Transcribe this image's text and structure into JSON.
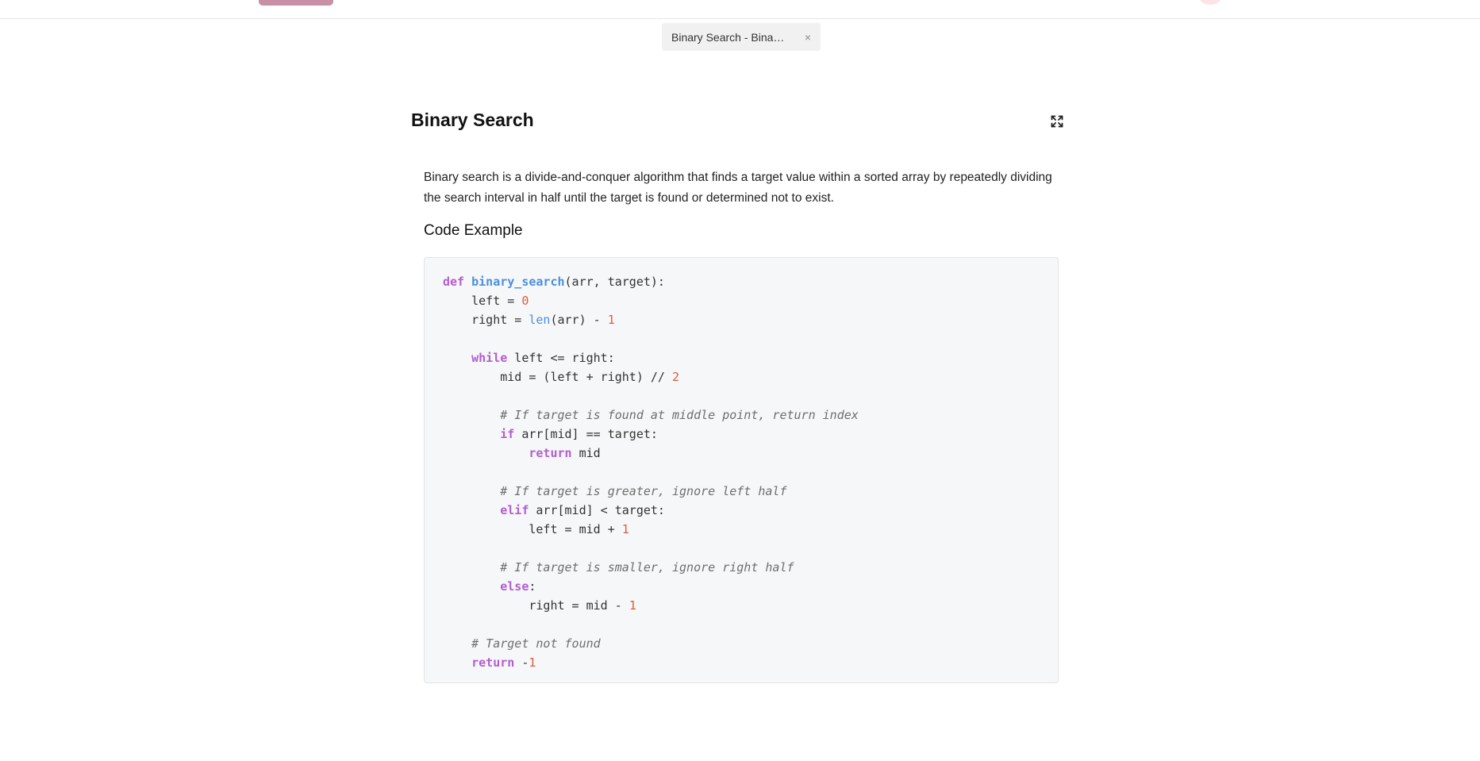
{
  "tab": {
    "title": "Binary Search - Binar…",
    "close_glyph": "×"
  },
  "document": {
    "title": "Binary Search",
    "expand_icon": "expand-icon",
    "description": "Binary search is a divide-and-conquer algorithm that finds a target value within a sorted array by repeatedly dividing the search interval in half until the target is found or determined not to exist.",
    "code_heading": "Code Example",
    "code_language": "python",
    "code_lines": [
      "def binary_search(arr, target):",
      "    left = 0",
      "    right = len(arr) - 1",
      "",
      "    while left <= right:",
      "        mid = (left + right) // 2",
      "",
      "        # If target is found at middle point, return index",
      "        if arr[mid] == target:",
      "            return mid",
      "",
      "        # If target is greater, ignore left half",
      "        elif arr[mid] < target:",
      "            left = mid + 1",
      "",
      "        # If target is smaller, ignore right half",
      "        else:",
      "            right = mid - 1",
      "",
      "    # Target not found",
      "    return -1"
    ]
  },
  "colors": {
    "keyword": "#b35ed0",
    "function": "#4a8fe0",
    "number": "#e5593a",
    "comment": "#6e6e6e",
    "code_background": "#f6f7f8",
    "tab_background": "#f1f1f1",
    "topbar_accent": "#c98fa6"
  }
}
